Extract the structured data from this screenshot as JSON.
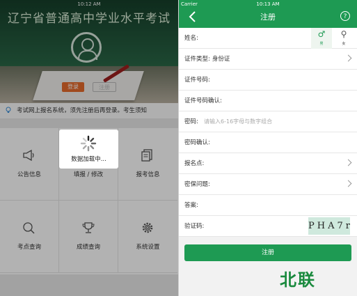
{
  "left": {
    "status": {
      "time": "10:12 AM"
    },
    "hero": {
      "title": "辽宁省普通高中学业水平考试",
      "login_label": "登录",
      "register_label": "注册"
    },
    "notice": "考试网上报名系统，须先注册后再登录。考生须知",
    "grid": [
      {
        "label": "公告信息",
        "icon": "megaphone-icon"
      },
      {
        "label": "填报 / 修改",
        "icon": "edit-icon"
      },
      {
        "label": "报考信息",
        "icon": "document-icon"
      },
      {
        "label": "考点查询",
        "icon": "search-icon"
      },
      {
        "label": "成绩查询",
        "icon": "trophy-icon"
      },
      {
        "label": "系统设置",
        "icon": "gear-icon"
      }
    ],
    "loading_text": "数据加载中..."
  },
  "right": {
    "status": {
      "carrier": "Carrier",
      "time": "10:13 AM"
    },
    "title": "注册",
    "help": "?",
    "fields": {
      "name": "姓名:",
      "gender_male": "男",
      "gender_female": "女",
      "id_type": "证件类型:",
      "id_type_value": "身份证",
      "id_number": "证件号码:",
      "id_confirm": "证件号码确认:",
      "password": "密码:",
      "password_placeholder": "请输入6-16字母与数字组合",
      "password_confirm": "密码确认:",
      "site": "报名点:",
      "security_q": "密保问题:",
      "answer": "答案:",
      "captcha": "验证码:",
      "captcha_value": "PHA7r"
    },
    "submit_label": "注册"
  },
  "watermark": "北联",
  "colors": {
    "primary": "#1e9a53",
    "accent": "#e56b2b"
  }
}
